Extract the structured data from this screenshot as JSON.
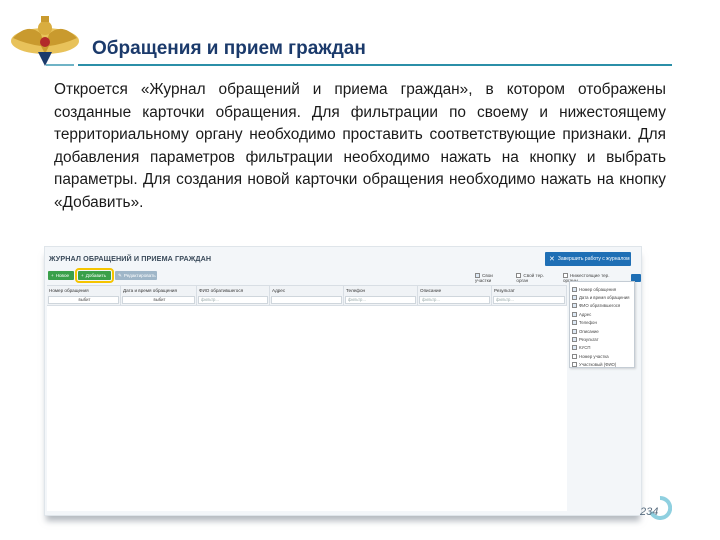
{
  "slide": {
    "title": "Обращения и прием граждан",
    "body": "Откроется «Журнал обращений и приема граждан», в котором отображены созданные карточки обращения. Для фильтрации по своему и нижестоящему территориальному органу необходимо проставить соответствующие признаки. Для добавления параметров фильтрации необходимо нажать на кнопку и выбрать параметры. Для создания новой карточки обращения необходимо нажать на кнопку «Добавить».",
    "page_number": "234",
    "emblem_icon": "double-headed-eagle-emblem"
  },
  "app": {
    "title": "ЖУРНАЛ ОБРАЩЕНИЙ И ПРИЕМА ГРАЖДАН",
    "close_button": "Завершить работу с журналом",
    "toolbar": {
      "new_label": "Новое",
      "add_label": "Добавить",
      "edit_label": "Редактировать"
    },
    "filters": {
      "own_area": "Свои участки",
      "own_org": "Свой тер. орган",
      "subordinate": "Нижестоящие тер. органы"
    },
    "columns": [
      {
        "label": "Номер обращения",
        "filter": "выбит"
      },
      {
        "label": "Дата и время обращения",
        "filter": "выбит"
      },
      {
        "label": "ФИО обратившегося",
        "filter": "фильтр..."
      },
      {
        "label": "Адрес",
        "filter": ""
      },
      {
        "label": "Телефон",
        "filter": "фильтр..."
      },
      {
        "label": "Описание",
        "filter": "фильтр..."
      },
      {
        "label": "Результат",
        "filter": "фильтр..."
      }
    ],
    "column_menu": [
      {
        "label": "Номер обращения",
        "checked": true
      },
      {
        "label": "Дата и время обращения",
        "checked": true
      },
      {
        "label": "ФИО обратившегося",
        "checked": true
      },
      {
        "label": "Адрес",
        "checked": true
      },
      {
        "label": "Телефон",
        "checked": true
      },
      {
        "label": "Описание",
        "checked": true
      },
      {
        "label": "Результат",
        "checked": true
      },
      {
        "label": "КУСП",
        "checked": true
      },
      {
        "label": "Номер участка",
        "checked": false
      },
      {
        "label": "Участковый (ФИО)",
        "checked": false
      }
    ],
    "accent_color": "#1f6fb5",
    "add_highlight_color": "#f5c400"
  }
}
